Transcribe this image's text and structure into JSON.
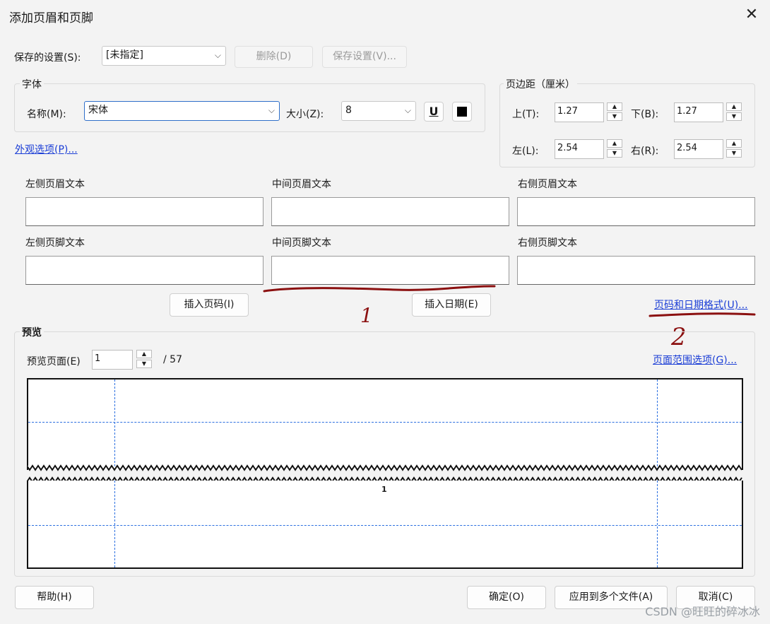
{
  "window": {
    "title": "添加页眉和页脚",
    "close_glyph": "✕"
  },
  "saved": {
    "label": "保存的设置(S):",
    "value": "[未指定]",
    "delete_label": "删除(D)",
    "save_label": "保存设置(V)..."
  },
  "font": {
    "group_label": "字体",
    "name_label": "名称(M):",
    "name_value": "宋体",
    "size_label": "大小(Z):",
    "size_value": "8",
    "underline_glyph": "U"
  },
  "appearance_link": "外观选项(P)...",
  "margins": {
    "group_label": "页边距（厘米）",
    "top_label": "上(T):",
    "top_value": "1.27",
    "bottom_label": "下(B):",
    "bottom_value": "1.27",
    "left_label": "左(L):",
    "left_value": "2.54",
    "right_label": "右(R):",
    "right_value": "2.54"
  },
  "header_labels": {
    "left": "左侧页眉文本",
    "center": "中间页眉文本",
    "right": "右侧页眉文本"
  },
  "footer_labels": {
    "left": "左侧页脚文本",
    "center": "中间页脚文本",
    "right": "右侧页脚文本"
  },
  "insert": {
    "page_number": "插入页码(I)",
    "date": "插入日期(E)",
    "format_link": "页码和日期格式(U)..."
  },
  "annotations": {
    "mark1": "1",
    "mark2": "2",
    "color": "#8b1010"
  },
  "preview": {
    "group_label": "预览",
    "page_label": "预览页面(E)",
    "page_value": "1",
    "total": "/ 57",
    "range_link": "页面范围选项(G)...",
    "footer_page_number": "1"
  },
  "footer_buttons": {
    "help": "帮助(H)",
    "ok": "确定(O)",
    "apply_multi": "应用到多个文件(A)",
    "cancel": "取消(C)"
  },
  "watermark": "CSDN @旺旺的碎冰冰"
}
